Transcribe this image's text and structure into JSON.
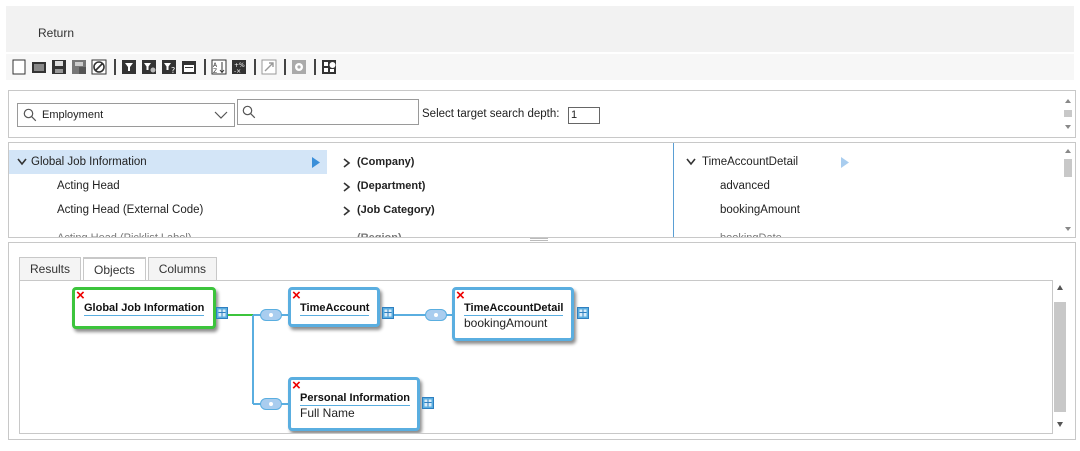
{
  "header": {
    "return_label": "Return"
  },
  "toolbar": {
    "icons": [
      "new-icon",
      "open-icon",
      "save-icon",
      "save-as-icon",
      "cancel-icon",
      "filter-icon",
      "filter-settings-icon",
      "filter-help-icon",
      "calendar-icon",
      "sort-icon",
      "calculate-icon",
      "export-icon",
      "settings-icon",
      "chart-icon"
    ]
  },
  "search": {
    "entity_select": "Employment",
    "search_value": "",
    "depth_label": "Select target search depth:",
    "depth_value": "1"
  },
  "tree": {
    "col1": {
      "header": "Global Job Information",
      "items": [
        "Acting Head",
        "Acting Head (External Code)",
        "Acting Head (Picklist Label)"
      ]
    },
    "col2": {
      "items": [
        "(Company)",
        "(Department)",
        "(Job Category)",
        "(Region)"
      ]
    },
    "col3": {
      "header": "TimeAccountDetail",
      "items": [
        "advanced",
        "bookingAmount",
        "bookingDate"
      ]
    }
  },
  "tabs": [
    {
      "label": "Results",
      "active": false
    },
    {
      "label": "Objects",
      "active": true
    },
    {
      "label": "Columns",
      "active": false
    }
  ],
  "diagram": {
    "nodes": {
      "global_job": {
        "title": "Global Job Information",
        "field": ""
      },
      "time_account": {
        "title": "TimeAccount",
        "field": ""
      },
      "time_account_detail": {
        "title": "TimeAccountDetail",
        "field": "bookingAmount"
      },
      "personal_info": {
        "title": "Personal Information",
        "field": "Full Name"
      }
    }
  },
  "colors": {
    "accent_blue": "#5aaee0",
    "selected_green": "#3cc43c",
    "remove_red": "#e00000",
    "selection_bg": "#d3e5f7"
  }
}
